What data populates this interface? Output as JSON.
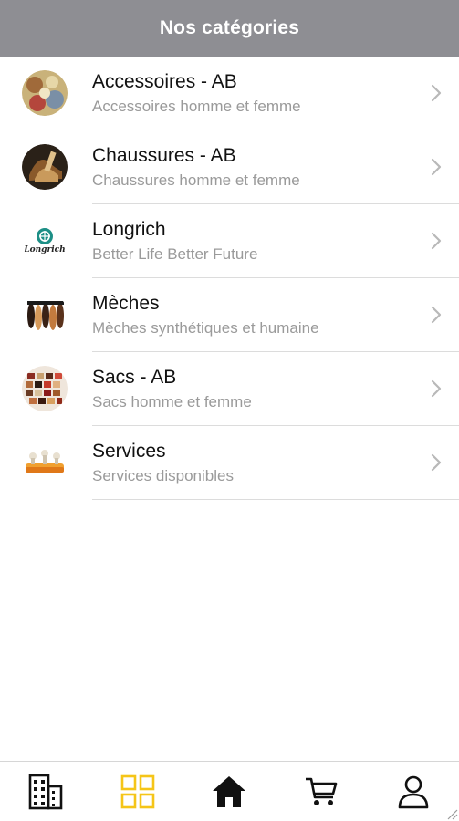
{
  "header": {
    "title": "Nos catégories"
  },
  "categories": [
    {
      "title": "Accessoires - AB",
      "subtitle": "Accessoires homme et femme",
      "icon": "accessories-thumbnail"
    },
    {
      "title": "Chaussures - AB",
      "subtitle": "Chaussures homme et femme",
      "icon": "shoes-thumbnail"
    },
    {
      "title": "Longrich",
      "subtitle": "Better Life Better Future",
      "icon": "longrich-logo",
      "logo_text": "Longrich"
    },
    {
      "title": "Mèches",
      "subtitle": "Mèches synthétiques et humaine",
      "icon": "hair-extensions-thumbnail"
    },
    {
      "title": "Sacs - AB",
      "subtitle": "Sacs homme et femme",
      "icon": "bags-thumbnail"
    },
    {
      "title": "Services",
      "subtitle": "Services disponibles",
      "icon": "services-thumbnail"
    }
  ],
  "tabbar": {
    "items": [
      {
        "icon": "building-icon",
        "active": false
      },
      {
        "icon": "grid-icon",
        "active": true
      },
      {
        "icon": "home-icon",
        "active": false
      },
      {
        "icon": "cart-icon",
        "active": false
      },
      {
        "icon": "user-icon",
        "active": false
      }
    ]
  },
  "colors": {
    "header_bg": "#8e8e93",
    "active_tab": "#f5c518",
    "separator": "#dcdcdc",
    "subtitle": "#9a9a9a"
  }
}
